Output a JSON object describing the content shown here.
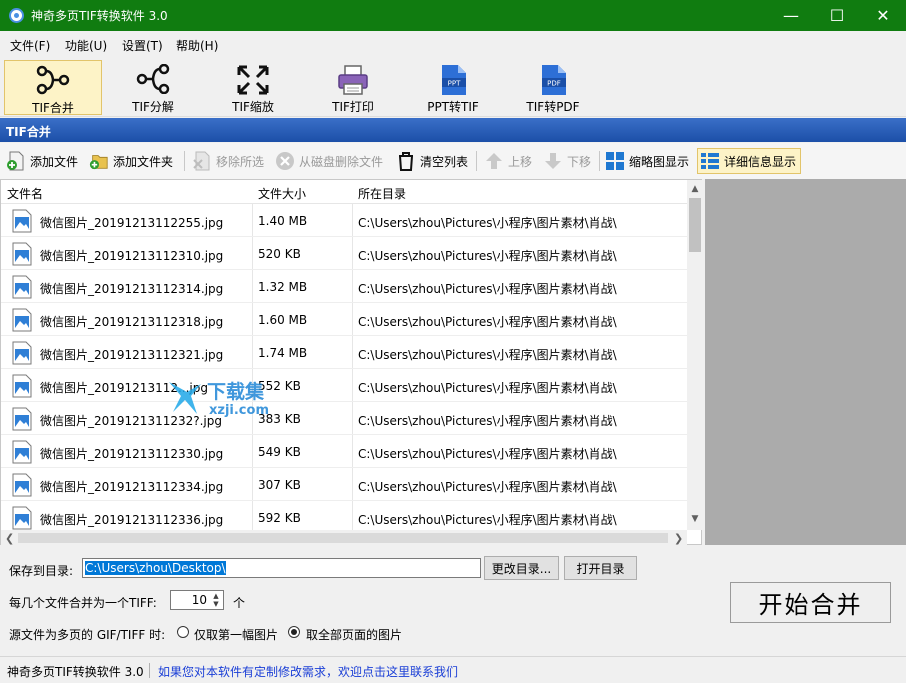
{
  "window": {
    "title": "神奇多页TIF转换软件 3.0"
  },
  "menu": [
    "文件(F)",
    "功能(U)",
    "设置(T)",
    "帮助(H)"
  ],
  "toolbar": {
    "items": [
      {
        "label": "TIF合并",
        "icon": "merge-icon",
        "active": true
      },
      {
        "label": "TIF分解",
        "icon": "split-icon",
        "active": false
      },
      {
        "label": "TIF缩放",
        "icon": "resize-icon",
        "active": false
      },
      {
        "label": "TIF打印",
        "icon": "printer-icon",
        "active": false
      },
      {
        "label": "PPT转TIF",
        "icon": "ppt-file-icon",
        "badge": "PPT",
        "active": false
      },
      {
        "label": "TIF转PDF",
        "icon": "pdf-file-icon",
        "badge": "PDF",
        "active": false
      }
    ]
  },
  "section_title": "TIF合并",
  "actions": {
    "add_file": "添加文件",
    "add_folder": "添加文件夹",
    "remove_selected": "移除所选",
    "delete_from_disk": "从磁盘删除文件",
    "clear_list": "清空列表",
    "move_up": "上移",
    "move_down": "下移",
    "thumbnail_view": "缩略图显示",
    "detail_view": "详细信息显示"
  },
  "list": {
    "columns": [
      "文件名",
      "文件大小",
      "所在目录"
    ],
    "rows": [
      {
        "name": "微信图片_20191213112255.jpg",
        "size": "1.40 MB",
        "dir": "C:\\Users\\zhou\\Pictures\\小程序\\图片素材\\肖战\\"
      },
      {
        "name": "微信图片_20191213112310.jpg",
        "size": "520 KB",
        "dir": "C:\\Users\\zhou\\Pictures\\小程序\\图片素材\\肖战\\"
      },
      {
        "name": "微信图片_20191213112314.jpg",
        "size": "1.32 MB",
        "dir": "C:\\Users\\zhou\\Pictures\\小程序\\图片素材\\肖战\\"
      },
      {
        "name": "微信图片_20191213112318.jpg",
        "size": "1.60 MB",
        "dir": "C:\\Users\\zhou\\Pictures\\小程序\\图片素材\\肖战\\"
      },
      {
        "name": "微信图片_20191213112321.jpg",
        "size": "1.74 MB",
        "dir": "C:\\Users\\zhou\\Pictures\\小程序\\图片素材\\肖战\\"
      },
      {
        "name": "微信图片_20191213112...jpg",
        "size": "552 KB",
        "dir": "C:\\Users\\zhou\\Pictures\\小程序\\图片素材\\肖战\\"
      },
      {
        "name": "微信图片_2019121311232?.jpg",
        "size": "383 KB",
        "dir": "C:\\Users\\zhou\\Pictures\\小程序\\图片素材\\肖战\\"
      },
      {
        "name": "微信图片_20191213112330.jpg",
        "size": "549 KB",
        "dir": "C:\\Users\\zhou\\Pictures\\小程序\\图片素材\\肖战\\"
      },
      {
        "name": "微信图片_20191213112334.jpg",
        "size": "307 KB",
        "dir": "C:\\Users\\zhou\\Pictures\\小程序\\图片素材\\肖战\\"
      },
      {
        "name": "微信图片_20191213112336.jpg",
        "size": "592 KB",
        "dir": "C:\\Users\\zhou\\Pictures\\小程序\\图片素材\\肖战\\"
      }
    ]
  },
  "save": {
    "label": "保存到目录:",
    "path": "C:\\Users\\zhou\\Desktop\\",
    "change_button": "更改目录...",
    "open_button": "打开目录"
  },
  "merge_count": {
    "label": "每几个文件合并为一个TIFF:",
    "value": "10",
    "unit": "个"
  },
  "multipage": {
    "label": "源文件为多页的 GIF/TIFF 时:",
    "option_first": "仅取第一幅图片",
    "option_all": "取全部页面的图片",
    "selected": "all"
  },
  "start_button": "开始合并",
  "status": {
    "left": "神奇多页TIF转换软件 3.0",
    "link": "如果您对本软件有定制修改需求，欢迎点击这里联系我们"
  },
  "watermark": {
    "text": "下载集",
    "sub": "xzji.com"
  },
  "colors": {
    "titlebar": "#107c10",
    "section": "#1c4fa8",
    "link": "#1a3ed6",
    "selection": "#0078d7"
  }
}
